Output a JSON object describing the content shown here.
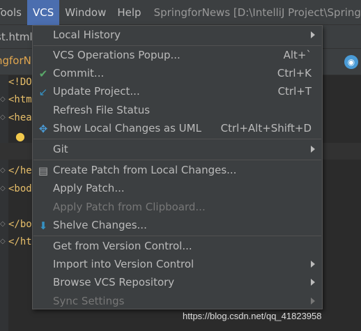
{
  "menubar": {
    "tools": "Tools",
    "vcs": "VCS",
    "window": "Window",
    "help": "Help",
    "title": "SpringforNews [D:\\IntelliJ Project\\Spring"
  },
  "tabs": {
    "file": "st.html"
  },
  "breadcrumb": {
    "project": "ngforN"
  },
  "editor": {
    "lines": [
      "<!DO",
      "<htm",
      "<hea",
      "</he",
      "<bod",
      "</bo",
      "</ht"
    ]
  },
  "menu": {
    "local_history": "Local History",
    "vcs_operations": "VCS Operations Popup...",
    "vcs_operations_sc": "Alt+`",
    "commit": "Commit...",
    "commit_sc": "Ctrl+K",
    "update": "Update Project...",
    "update_sc": "Ctrl+T",
    "refresh": "Refresh File Status",
    "show_changes": "Show Local Changes as UML",
    "show_changes_sc": "Ctrl+Alt+Shift+D",
    "git": "Git",
    "create_patch": "Create Patch from Local Changes...",
    "apply_patch": "Apply Patch...",
    "apply_clipboard": "Apply Patch from Clipboard...",
    "shelve": "Shelve Changes...",
    "get_vc": "Get from Version Control...",
    "import_vc": "Import into Version Control",
    "browse_repo": "Browse VCS Repository",
    "sync": "Sync Settings"
  },
  "watermark": "https://blog.csdn.net/qq_41823958",
  "colors": {
    "accent": "#4b6eaf",
    "commit_check": "#59a869",
    "update_arrow": "#3592c4"
  }
}
